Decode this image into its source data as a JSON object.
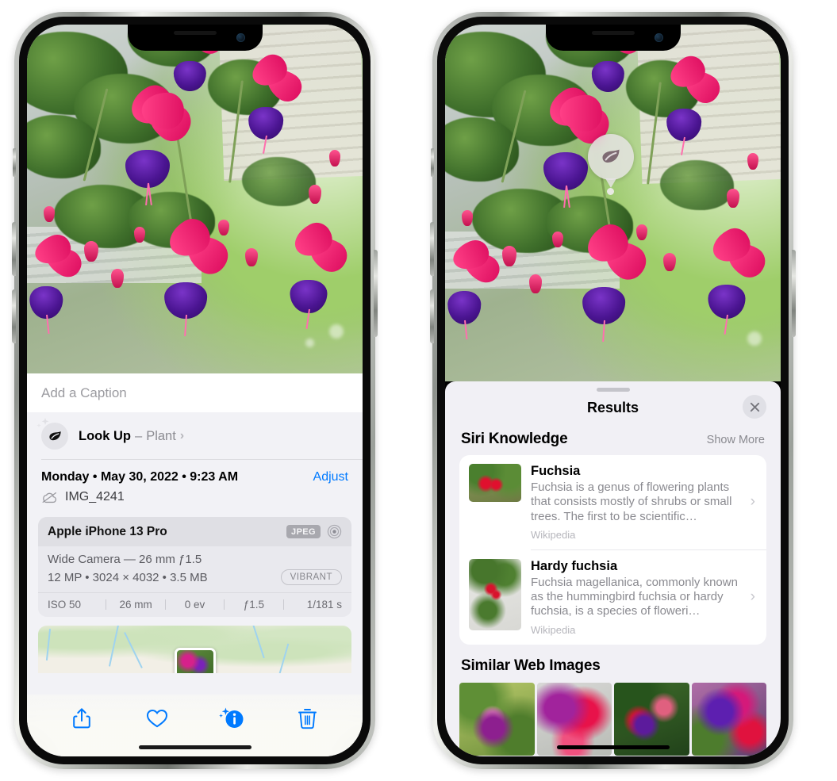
{
  "left_phone": {
    "caption": {
      "placeholder": "Add a Caption",
      "value": ""
    },
    "lookup": {
      "icon": "leaf-icon",
      "sparkle_icon": "sparkles-icon",
      "label": "Look Up",
      "dash": "–",
      "category": "Plant",
      "chevron": "›"
    },
    "date": {
      "text": "Monday • May 30, 2022 • 9:23 AM",
      "adjust_label": "Adjust",
      "cloud_icon": "cloud-slash-icon",
      "filename": "IMG_4241"
    },
    "exif": {
      "model": "Apple iPhone 13 Pro",
      "format_badge": "JPEG",
      "aperture_icon": "aperture-icon",
      "lens_line": "Wide Camera — 26 mm ƒ1.5",
      "size_line": "12 MP • 3024 × 4032 • 3.5 MB",
      "style_badge": "VIBRANT",
      "stats": [
        "ISO 50",
        "26 mm",
        "0 ev",
        "ƒ1.5",
        "1/181 s"
      ]
    },
    "map": {
      "pin_label": "photo-pin"
    },
    "toolbar": [
      {
        "name": "share-button",
        "icon": "share-icon",
        "color": "#007aff"
      },
      {
        "name": "favorite-button",
        "icon": "heart-icon",
        "color": "#007aff"
      },
      {
        "name": "info-button",
        "icon": "info-sparkle-icon",
        "color": "#007aff"
      },
      {
        "name": "delete-button",
        "icon": "trash-icon",
        "color": "#007aff"
      }
    ]
  },
  "right_phone": {
    "visual_lookup_badge": {
      "icon": "leaf-icon"
    },
    "sheet": {
      "title": "Results",
      "close_icon": "close-icon",
      "grabber": "drag-handle"
    },
    "siri_knowledge": {
      "title": "Siri Knowledge",
      "action": "Show More",
      "items": [
        {
          "title": "Fuchsia",
          "description": "Fuchsia is a genus of flowering plants that consists mostly of shrubs or small trees. The first to be scientific…",
          "source": "Wikipedia",
          "chevron": "›"
        },
        {
          "title": "Hardy fuchsia",
          "description": "Fuchsia magellanica, commonly known as the hummingbird fuchsia or hardy fuchsia, is a species of floweri…",
          "source": "Wikipedia",
          "chevron": "›"
        }
      ]
    },
    "similar_web_images": {
      "title": "Similar Web Images",
      "images": [
        "web-image-1",
        "web-image-2",
        "web-image-3",
        "web-image-4"
      ]
    }
  },
  "colors": {
    "accent": "#007aff",
    "panel_bg": "#f2f2f6",
    "sheet_bg": "#f1f0f5",
    "card_bg": "#ffffff",
    "secondary_text": "#8a8a90"
  }
}
